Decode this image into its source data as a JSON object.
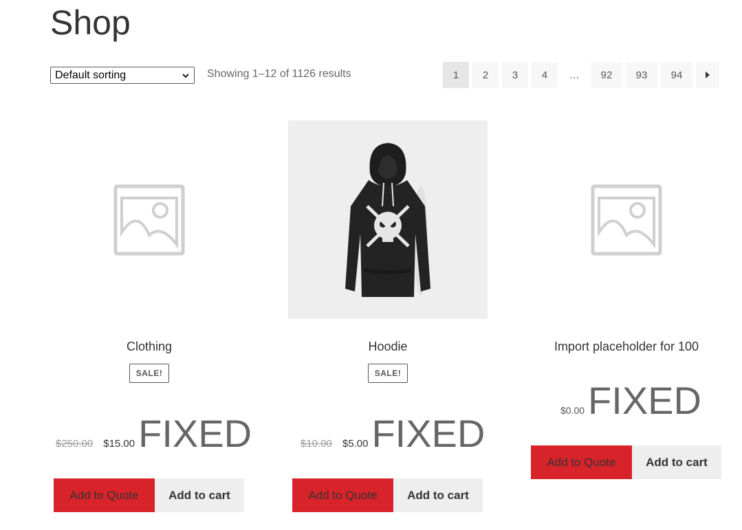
{
  "page": {
    "title": "Shop"
  },
  "toolbar": {
    "sort_value": "Default sorting",
    "result_count": "Showing 1–12 of 1126 results"
  },
  "pagination": {
    "pages": [
      "1",
      "2",
      "3",
      "4",
      "…",
      "92",
      "93",
      "94"
    ],
    "current": "1",
    "next_icon": "triangle-right-icon"
  },
  "products": [
    {
      "name": "Clothing",
      "image": "placeholder-image-icon",
      "badge": "SALE!",
      "price_old": "$250.00",
      "price_new": "$15.00",
      "price_suffix": "FIXED",
      "quote_label": "Add to Quote",
      "cart_label": "Add to cart"
    },
    {
      "name": "Hoodie",
      "image": "hoodie-photo",
      "badge": "SALE!",
      "price_old": "$10.00",
      "price_new": "$5.00",
      "price_suffix": "FIXED",
      "quote_label": "Add to Quote",
      "cart_label": "Add to cart"
    },
    {
      "name": "Import placeholder for 100",
      "image": "placeholder-image-icon",
      "price_new": "$0.00",
      "price_suffix": "FIXED",
      "quote_label": "Add to Quote",
      "cart_label": "Add to cart"
    }
  ],
  "colors": {
    "accent_red": "#d9232a",
    "button_grey": "#eeeeee",
    "page_current": "#e6e6e6"
  }
}
